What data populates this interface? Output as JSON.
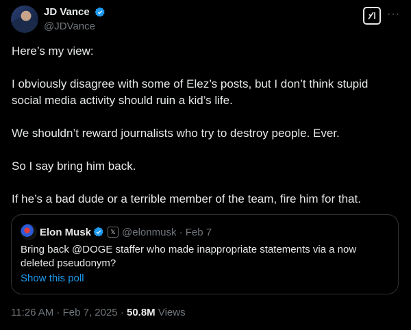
{
  "author": {
    "display_name": "JD Vance",
    "handle": "@JDVance"
  },
  "actions": {
    "grok_icon": "grok-icon",
    "more_label": "···"
  },
  "post": {
    "paragraphs": [
      "Here’s my view:",
      "I obviously disagree with some of Elez’s posts, but I don’t think stupid social media activity should ruin a kid’s life.",
      "We shouldn’t reward journalists who try to destroy people. Ever.",
      "So I say bring him back.",
      "If he’s a bad dude or a terrible member of the team, fire him for that."
    ]
  },
  "quote": {
    "display_name": "Elon Musk",
    "handle_date": "@elonmusk · Feb 7",
    "text": "Bring back @DOGE staffer who made inappropriate statements via a now deleted pseudonym?",
    "poll_link": "Show this poll"
  },
  "meta": {
    "timestamp": "11:26 AM · Feb 7, 2025 · ",
    "views_count": "50.8M",
    "views_label": " Views"
  },
  "colors": {
    "background": "#000000",
    "text": "#e7e9ea",
    "muted": "#71767b",
    "accent": "#1d9bf0",
    "border": "#2f3336"
  }
}
